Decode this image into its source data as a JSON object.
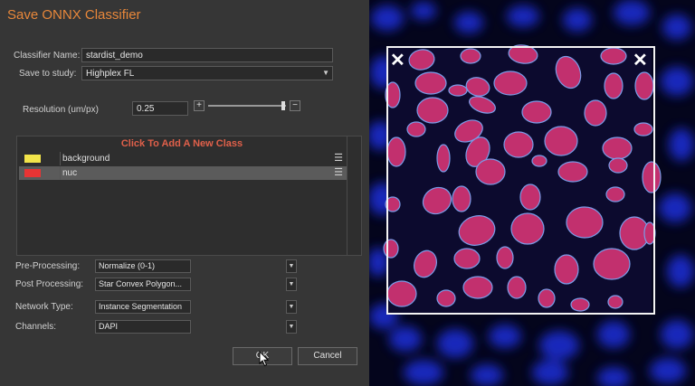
{
  "dialog": {
    "title": "Save ONNX Classifier",
    "classifier_name_label": "Classifier Name:",
    "classifier_name_value": "stardist_demo",
    "save_to_study_label": "Save to study:",
    "save_to_study_value": "Highplex FL",
    "resolution_label": "Resolution (um/px)",
    "resolution_value": "0.25",
    "resolution_plus": "+",
    "resolution_minus": "−",
    "resolution_slider_level": 0.95,
    "classes_header": "Click To Add A New Class",
    "classes": [
      {
        "name": "background",
        "color": "#f2e44a",
        "selected": false
      },
      {
        "name": "nuc",
        "color": "#e83434",
        "selected": true
      }
    ],
    "handle_glyph": "☰",
    "pre_processing_label": "Pre-Processing:",
    "pre_processing_value": "Normalize (0-1)",
    "post_processing_label": "Post Processing:",
    "post_processing_value": "Star Convex Polygon...",
    "network_type_label": "Network Type:",
    "network_type_value": "Instance Segmentation",
    "channels_label": "Channels:",
    "channels_value": "DAPI",
    "ok_label": "OK",
    "cancel_label": "Cancel"
  },
  "preview": {
    "close_icons": [
      "close-icon",
      "close-icon"
    ]
  },
  "colors": {
    "title": "#e8873a",
    "class_header": "#e0604a",
    "dialog_bg": "#363636",
    "nucleus_fill": "#c2306e",
    "nucleus_outline": "#7a9ce8",
    "dapi_blue": "#1f2fd8"
  }
}
